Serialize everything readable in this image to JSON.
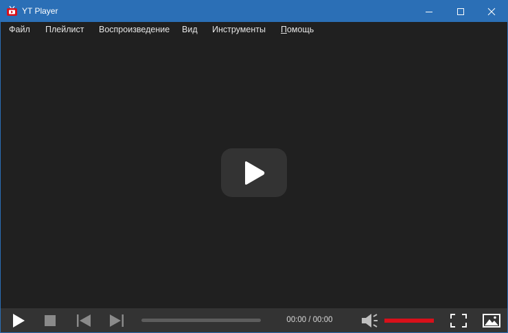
{
  "window": {
    "title": "YT Player",
    "app_icon": "yt-player-tv-icon",
    "controls": [
      "minimize-icon",
      "maximize-icon",
      "close-icon"
    ]
  },
  "menu": {
    "items": [
      {
        "label": "Файл"
      },
      {
        "label": "Плейлист"
      },
      {
        "label": "Воспроизведение"
      },
      {
        "label": "Вид"
      },
      {
        "label": "Инструменты"
      },
      {
        "label": "Помощь"
      }
    ]
  },
  "video": {
    "center_button_icon": "play-icon"
  },
  "controls": {
    "buttons": [
      "play-icon",
      "stop-icon",
      "previous-icon",
      "next-icon",
      "volume-icon",
      "fullscreen-icon",
      "picture-icon"
    ],
    "time_display": "00:00 / 00:00",
    "seek_progress": 0.0,
    "volume_level": 1.0
  },
  "colors": {
    "titlebar": "#2b6fb6",
    "background": "#202020",
    "controlbar": "#333333",
    "volume_accent": "#d9101a",
    "app_icon_red": "#d9101a"
  }
}
